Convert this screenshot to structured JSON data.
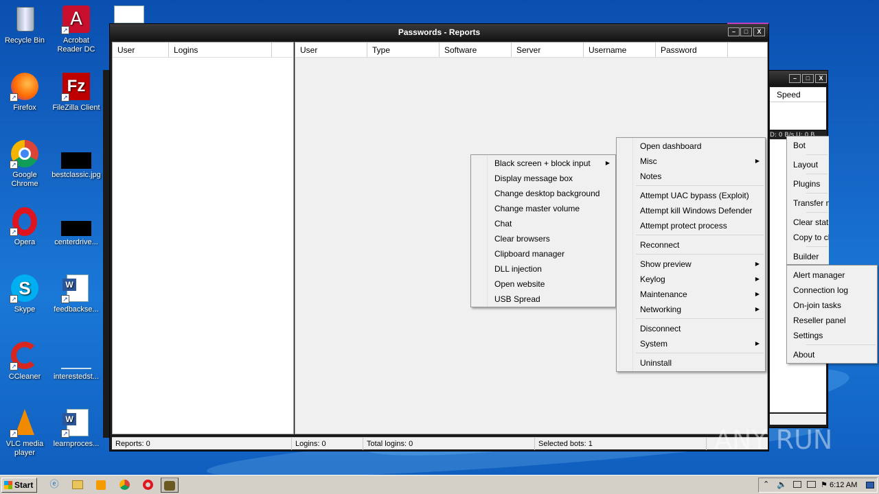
{
  "desktop": {
    "icons": [
      {
        "label": "Recycle Bin"
      },
      {
        "label": "Acrobat Reader DC"
      },
      {
        "label": "Firefox"
      },
      {
        "label": "FileZilla Client"
      },
      {
        "label": "Google Chrome"
      },
      {
        "label": "bestclassic.jpg"
      },
      {
        "label": "Opera"
      },
      {
        "label": "centerdrive..."
      },
      {
        "label": "Skype"
      },
      {
        "label": "feedbackse..."
      },
      {
        "label": "CCleaner"
      },
      {
        "label": "interestedst..."
      },
      {
        "label": "VLC media player"
      },
      {
        "label": "learnproces..."
      }
    ]
  },
  "main_window": {
    "title": "Passwords - Reports",
    "left_headers": [
      "User",
      "Logins"
    ],
    "right_headers": [
      "User",
      "Type",
      "Software",
      "Server",
      "Username",
      "Password"
    ],
    "status": {
      "reports": "Reports: 0",
      "logins": "Logins: 0",
      "total_logins": "Total logins: 0",
      "selected_bots": "Selected bots: 1"
    }
  },
  "back_window": {
    "column_header": "Speed",
    "status_strip": "D: 0 B/s U: 0 B"
  },
  "misc_menu": {
    "items": [
      "Black screen + block input",
      "Display message box",
      "Change desktop background",
      "Change master volume",
      "Chat",
      "Clear browsers",
      "Clipboard manager",
      "DLL injection",
      "Open website",
      "USB Spread"
    ]
  },
  "bot_menu": {
    "groups": [
      [
        "Open dashboard",
        "Misc",
        "Notes"
      ],
      [
        "Attempt UAC bypass (Exploit)",
        "Attempt kill Windows Defender",
        "Attempt protect process"
      ],
      [
        "Reconnect"
      ],
      [
        "Show preview",
        "Keylog",
        "Maintenance",
        "Networking"
      ],
      [
        "Disconnect",
        "System"
      ],
      [
        "Uninstall"
      ]
    ]
  },
  "side_menu": {
    "items_a": [
      "Bot",
      "Layout",
      "Plugins",
      "Transfer m",
      "Clear stati",
      "Copy to cl",
      "Builder"
    ],
    "items_b": [
      "Alert manager",
      "Connection log",
      "On-join tasks",
      "Reseller panel",
      "Settings",
      "About"
    ]
  },
  "taskbar": {
    "start_label": "Start",
    "clock": "6:12 AM"
  },
  "watermark": "ANY RUN"
}
